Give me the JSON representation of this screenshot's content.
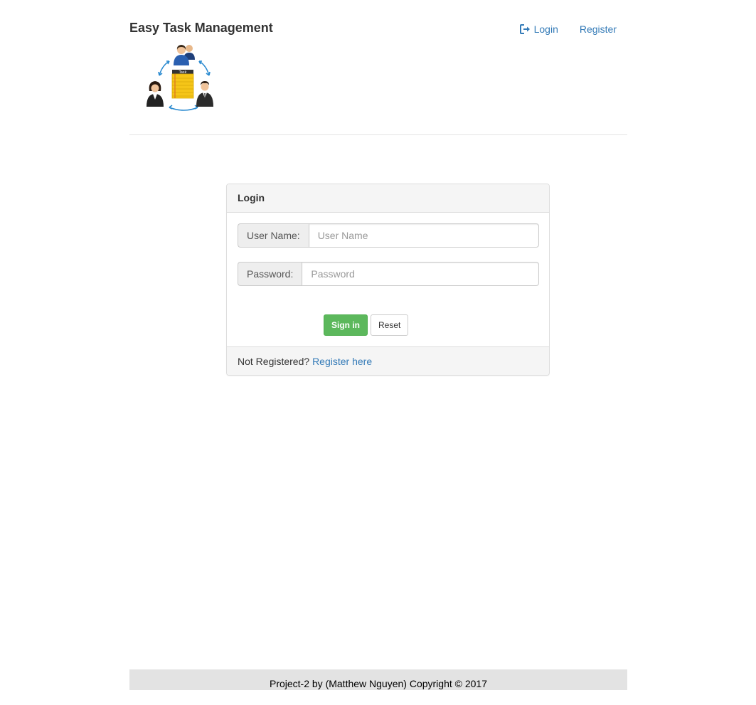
{
  "header": {
    "brand": "Easy Task Management",
    "logo_alt": "team-task-logo",
    "logo_text": "Task",
    "nav": {
      "login_label": "Login",
      "login_icon": "sign-in-icon",
      "register_label": "Register"
    }
  },
  "login_panel": {
    "title": "Login",
    "username": {
      "label": "User Name:",
      "placeholder": "User Name",
      "value": ""
    },
    "password": {
      "label": "Password:",
      "placeholder": "Password",
      "value": ""
    },
    "sign_in_label": "Sign in",
    "reset_label": "Reset",
    "footer_text": "Not Registered?",
    "footer_link": "Register here"
  },
  "footer": {
    "text": "Project-2 by (Matthew Nguyen) Copyright © 2017"
  },
  "colors": {
    "link": "#337ab7",
    "success": "#5cb85c",
    "panel_bg": "#f5f5f5",
    "footer_bg": "#e3e3e3"
  }
}
